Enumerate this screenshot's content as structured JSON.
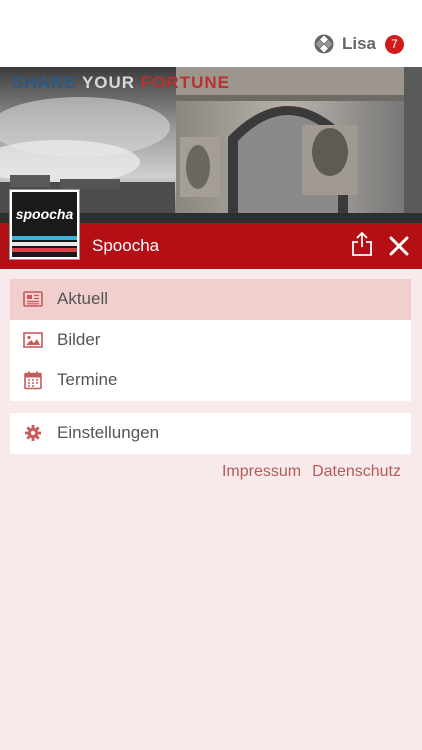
{
  "header": {
    "user_name": "Lisa",
    "notification_count": "7",
    "user_icon": "puzzle-user-icon"
  },
  "hero": {
    "slogan_word1": "SHARE",
    "slogan_word2": "YOUR",
    "slogan_word3": "FORTUNE"
  },
  "brand": {
    "logo_text": "spoocha",
    "name": "Spoocha",
    "share_icon": "share-icon",
    "close_icon": "close-icon"
  },
  "menu": {
    "items": [
      {
        "label": "Aktuell",
        "icon": "newspaper-icon",
        "active": true
      },
      {
        "label": "Bilder",
        "icon": "image-icon"
      },
      {
        "label": "Termine",
        "icon": "calendar-icon"
      }
    ],
    "settings": {
      "label": "Einstellungen",
      "icon": "gear-icon"
    }
  },
  "footer": {
    "impressum": "Impressum",
    "datenschutz": "Datenschutz"
  },
  "colors": {
    "accent": "#b40f14",
    "background": "#f8eaea",
    "active_item": "#f1cfcf",
    "icon": "#c85a5a",
    "badge": "#d01c1c"
  }
}
